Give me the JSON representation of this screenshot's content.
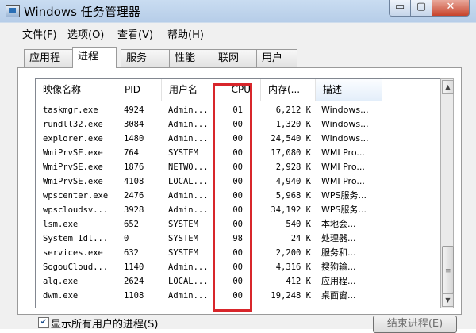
{
  "window": {
    "title": "Windows 任务管理器"
  },
  "controls": {
    "minimize": "▭",
    "maximize": "▢",
    "close": "✕"
  },
  "menu": [
    "文件(F)",
    "选项(O)",
    "查看(V)",
    "帮助(H)"
  ],
  "tabs": [
    "应用程序",
    "进程",
    "服务",
    "性能",
    "联网",
    "用户"
  ],
  "active_tab": "进程",
  "columns": [
    "映像名称",
    "PID",
    "用户名",
    "CPU",
    "内存(...",
    "描述"
  ],
  "processes": [
    {
      "name": "taskmgr.exe",
      "pid": "4924",
      "user": "Admin...",
      "cpu": "01",
      "mem": "6,212 K",
      "desc": "Windows..."
    },
    {
      "name": "rundll32.exe",
      "pid": "3084",
      "user": "Admin...",
      "cpu": "00",
      "mem": "1,320 K",
      "desc": "Windows..."
    },
    {
      "name": "explorer.exe",
      "pid": "1480",
      "user": "Admin...",
      "cpu": "00",
      "mem": "24,540 K",
      "desc": "Windows..."
    },
    {
      "name": "WmiPrvSE.exe",
      "pid": "764",
      "user": "SYSTEM",
      "cpu": "00",
      "mem": "17,080 K",
      "desc": "WMI Pro..."
    },
    {
      "name": "WmiPrvSE.exe",
      "pid": "1876",
      "user": "NETWO...",
      "cpu": "00",
      "mem": "2,928 K",
      "desc": "WMI Pro..."
    },
    {
      "name": "WmiPrvSE.exe",
      "pid": "4108",
      "user": "LOCAL...",
      "cpu": "00",
      "mem": "4,940 K",
      "desc": "WMI Pro..."
    },
    {
      "name": "wpscenter.exe",
      "pid": "2476",
      "user": "Admin...",
      "cpu": "00",
      "mem": "5,968 K",
      "desc": "WPS服务..."
    },
    {
      "name": "wpscloudsv...",
      "pid": "3928",
      "user": "Admin...",
      "cpu": "00",
      "mem": "34,192 K",
      "desc": "WPS服务..."
    },
    {
      "name": "lsm.exe",
      "pid": "652",
      "user": "SYSTEM",
      "cpu": "00",
      "mem": "540 K",
      "desc": "本地会..."
    },
    {
      "name": "System Idl...",
      "pid": "0",
      "user": "SYSTEM",
      "cpu": "98",
      "mem": "24 K",
      "desc": "处理器..."
    },
    {
      "name": "services.exe",
      "pid": "632",
      "user": "SYSTEM",
      "cpu": "00",
      "mem": "2,200 K",
      "desc": "服务和..."
    },
    {
      "name": "SogouCloud...",
      "pid": "1140",
      "user": "Admin...",
      "cpu": "00",
      "mem": "4,316 K",
      "desc": "搜狗输..."
    },
    {
      "name": "alg.exe",
      "pid": "2624",
      "user": "LOCAL...",
      "cpu": "00",
      "mem": "412 K",
      "desc": "应用程..."
    },
    {
      "name": "dwm.exe",
      "pid": "1108",
      "user": "Admin...",
      "cpu": "00",
      "mem": "19,248 K",
      "desc": "桌面窗..."
    }
  ],
  "show_all_users": {
    "label": "显示所有用户的进程(S)",
    "checked": "✔"
  },
  "end_process_label": "结束进程(E)",
  "highlight_color": "#d8262b"
}
